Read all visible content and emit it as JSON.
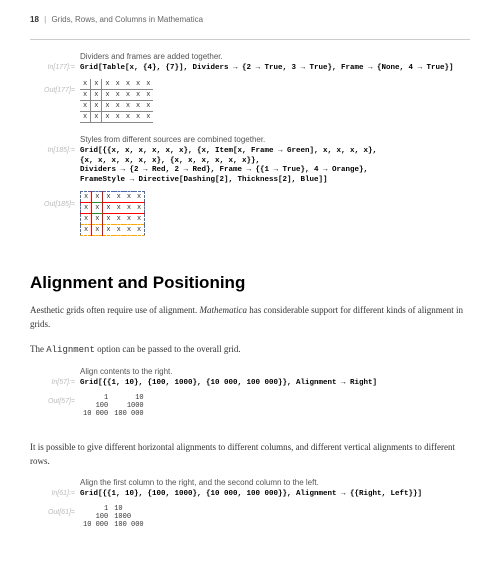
{
  "header": {
    "page": "18",
    "title": "Grids, Rows, and Columns in Mathematica"
  },
  "block1": {
    "caption": "Dividers and frames are added together.",
    "inlabel": "In[177]:=",
    "code": "Grid[Table[x, {4}, {7}], Dividers → {2 → True, 3 → True}, Frame → {None, 4 → True}]",
    "outlabel": "Out[177]="
  },
  "block2": {
    "caption": "Styles from different sources are combined together.",
    "inlabel": "In[185]:=",
    "code1": "Grid[{{x, x, x, x, x, x}, {x, Item[x, Frame → Green], x, x, x, x},",
    "code2": "  {x, x, x, x, x, x}, {x, x, x, x, x, x}},",
    "code3": " Dividers → {2 → Red, 2 → Red}, Frame → {{1 → True}, 4 → Orange},",
    "code4": " FrameStyle → Directive[Dashing[2], Thickness[2], Blue]]",
    "outlabel": "Out[185]="
  },
  "section": {
    "heading": "Alignment and Positioning",
    "para1a": "Aesthetic grids often require use of alignment. ",
    "para1b": "Mathematica",
    "para1c": " has considerable support for different kinds of alignment in grids.",
    "para2a": "The ",
    "para2b": "Alignment",
    "para2c": " option can be passed to the overall grid."
  },
  "block3": {
    "caption": "Align contents to the right.",
    "inlabel": "In[57]:=",
    "code": "Grid[{{1, 10}, {100, 1000}, {10 000, 100 000}}, Alignment → Right]",
    "outlabel": "Out[57]=",
    "rows": [
      [
        "1",
        "10"
      ],
      [
        "100",
        "1000"
      ],
      [
        "10 000",
        "100 000"
      ]
    ]
  },
  "para3": "It is possible to give different horizontal alignments to different columns, and different vertical alignments to different rows.",
  "block4": {
    "caption": "Align the first column to the right, and the second column to the left.",
    "inlabel": "In[61]:=",
    "code": "Grid[{{1, 10}, {100, 1000}, {10 000, 100 000}}, Alignment → {{Right, Left}}]",
    "outlabel": "Out[61]=",
    "rows": [
      [
        "1",
        "10"
      ],
      [
        "100",
        "1000"
      ],
      [
        "10 000",
        "100 000"
      ]
    ]
  }
}
